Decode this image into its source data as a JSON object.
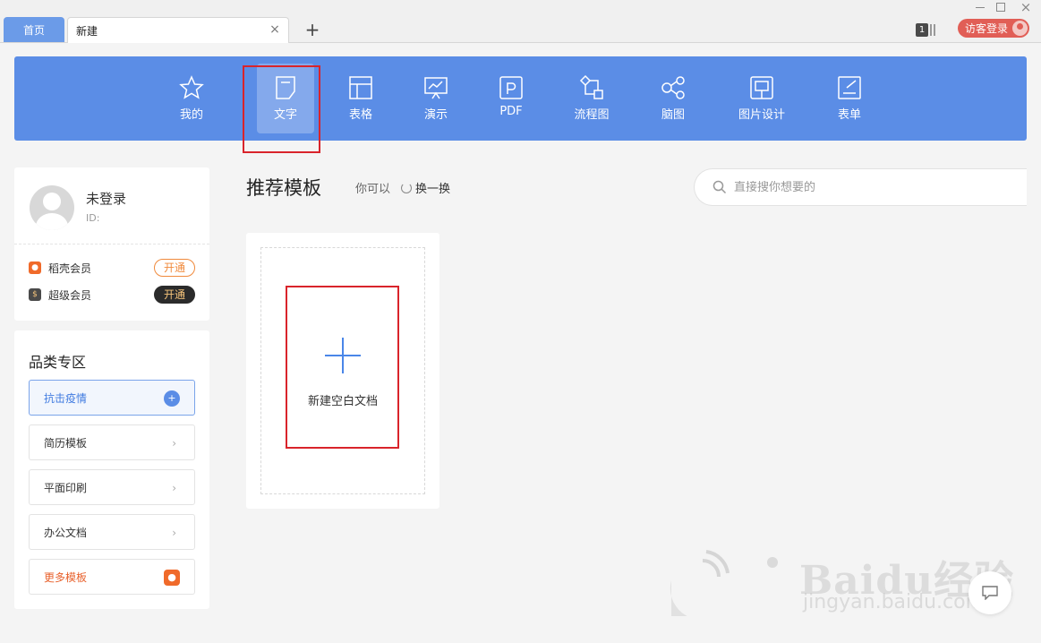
{
  "tabs": {
    "home": "首页",
    "current": "新建",
    "close": "×",
    "add": "+"
  },
  "topbar": {
    "count_badge": "1",
    "guest_login": "访客登录"
  },
  "categories": [
    {
      "label": "我的",
      "icon": "star-icon"
    },
    {
      "label": "文字",
      "icon": "document-icon",
      "active": true
    },
    {
      "label": "表格",
      "icon": "table-icon"
    },
    {
      "label": "演示",
      "icon": "presentation-icon"
    },
    {
      "label": "PDF",
      "icon": "pdf-icon"
    },
    {
      "label": "流程图",
      "icon": "flowchart-icon"
    },
    {
      "label": "脑图",
      "icon": "mindmap-icon"
    },
    {
      "label": "图片设计",
      "icon": "image-design-icon"
    },
    {
      "label": "表单",
      "icon": "form-icon"
    }
  ],
  "user": {
    "name": "未登录",
    "id_label": "ID:"
  },
  "membership": [
    {
      "label": "稻壳会员",
      "button": "开通",
      "color": "#f06a2a"
    },
    {
      "label": "超级会员",
      "button": "开通",
      "color": "#4a4a4a"
    }
  ],
  "category_panel": {
    "title": "品类专区",
    "items": [
      {
        "label": "抗击疫情"
      },
      {
        "label": "简历模板"
      },
      {
        "label": "平面印刷"
      },
      {
        "label": "办公文档"
      },
      {
        "label": "更多模板"
      }
    ]
  },
  "main": {
    "title": "推荐模板",
    "hint": "你可以",
    "refresh": "换一换",
    "search_placeholder": "直接搜你想要的",
    "new_blank": "新建空白文档"
  },
  "watermark": {
    "brand": "Baidu经验",
    "url": "jingyan.baidu.com"
  },
  "colors": {
    "accent": "#5b8de6",
    "highlight": "#d9242b",
    "docer": "#f06a2a"
  }
}
